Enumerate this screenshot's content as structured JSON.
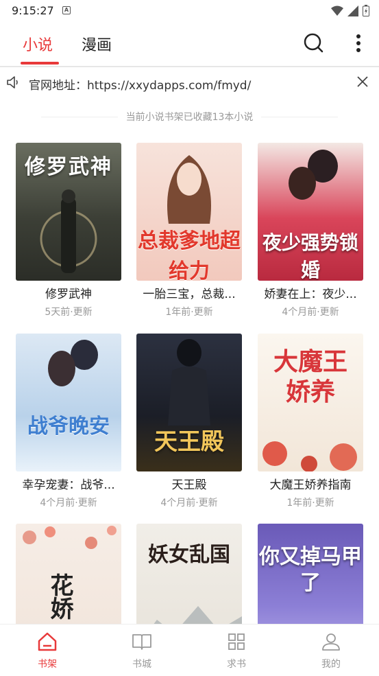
{
  "status_bar": {
    "time": "9:15:27",
    "notification_icon": "A"
  },
  "top_tabs": [
    {
      "label": "小说",
      "active": true
    },
    {
      "label": "漫画",
      "active": false
    }
  ],
  "notice": {
    "text": "官网地址：https://xxydapps.com/fmyd/"
  },
  "shelf_count_text": "当前小说书架已收藏13本小说",
  "books": [
    {
      "title": "修罗武神",
      "updated": "5天前·更新",
      "cover_text": "修罗武神",
      "cover_bg": "#4a4e44"
    },
    {
      "title": "一胎三宝，总裁...",
      "updated": "1年前·更新",
      "cover_text": "总裁爹地超给力",
      "cover_bg": "#f3d6cd"
    },
    {
      "title": "娇妻在上：夜少...",
      "updated": "4个月前·更新",
      "cover_text": "夜少强势锁婚",
      "cover_bg": "#c9324a"
    },
    {
      "title": "幸孕宠妻：战爷...",
      "updated": "4个月前·更新",
      "cover_text": "战爷晚安",
      "cover_bg": "#b9d2ea"
    },
    {
      "title": "天王殿",
      "updated": "4个月前·更新",
      "cover_text": "天王殿",
      "cover_bg": "#20242e"
    },
    {
      "title": "大魔王娇养指南",
      "updated": "1年前·更新",
      "cover_text": "大魔王娇养",
      "cover_bg": "#f6efe6"
    },
    {
      "title": "",
      "updated": "",
      "cover_text": "花娇",
      "cover_bg": "#f5ece4"
    },
    {
      "title": "",
      "updated": "",
      "cover_text": "妖女乱国",
      "cover_bg": "#eeeae3"
    },
    {
      "title": "",
      "updated": "",
      "cover_text": "你又掉马甲了",
      "cover_bg": "#7d6fc6"
    }
  ],
  "bottom_nav": [
    {
      "label": "书架",
      "icon": "home-icon",
      "active": true
    },
    {
      "label": "书城",
      "icon": "book-icon",
      "active": false
    },
    {
      "label": "求书",
      "icon": "grid-icon",
      "active": false
    },
    {
      "label": "我的",
      "icon": "user-icon",
      "active": false
    }
  ],
  "colors": {
    "accent": "#e8393a",
    "muted": "#999999"
  }
}
